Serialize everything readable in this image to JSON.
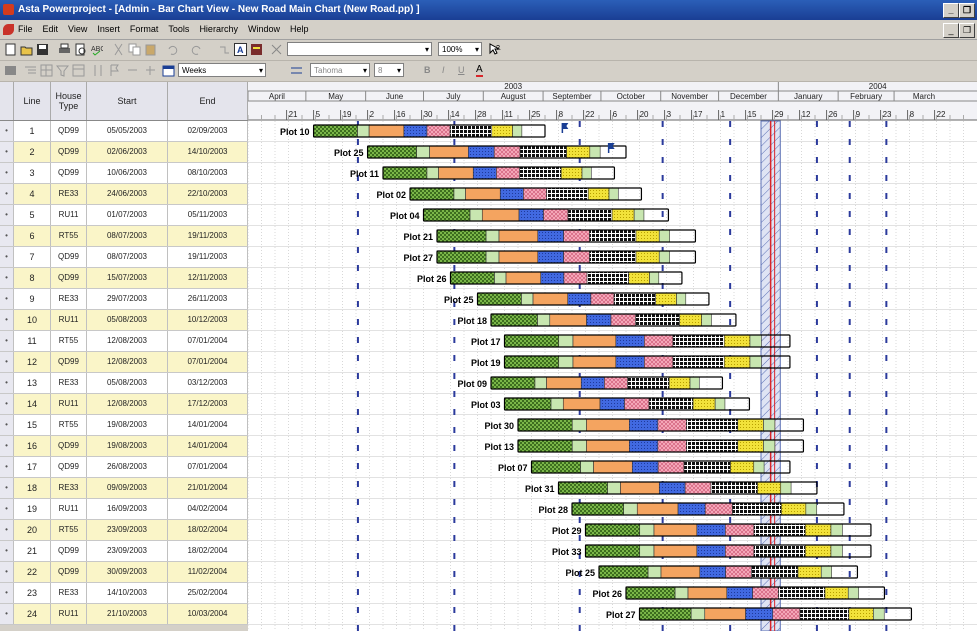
{
  "window": {
    "title": "Asta Powerproject - [Admin - Bar Chart View - New Road Main Chart (New Road.pp) ]",
    "min_label": "_",
    "restore_label": "❐"
  },
  "menu": {
    "items": [
      "File",
      "Edit",
      "View",
      "Insert",
      "Format",
      "Tools",
      "Hierarchy",
      "Window",
      "Help"
    ]
  },
  "toolbar": {
    "zoom": "100%",
    "timescale": "Weeks",
    "font": "Tahoma",
    "font_size": "8",
    "bold": "B",
    "italic": "I",
    "underline": "U",
    "text_color": "A"
  },
  "columns": {
    "line": "Line",
    "house_type": "House Type",
    "start": "Start",
    "end": "End"
  },
  "years": [
    {
      "label": "2003",
      "month_index": 0
    },
    {
      "label": "2004",
      "month_index": 9
    }
  ],
  "months": [
    "April",
    "May",
    "June",
    "July",
    "August",
    "September",
    "October",
    "November",
    "December",
    "January",
    "February",
    "March"
  ],
  "week_ticks": [
    "21",
    "5",
    "19",
    "2",
    "16",
    "30",
    "14",
    "28",
    "11",
    "25",
    "8",
    "22",
    "6",
    "20",
    "3",
    "17",
    "1",
    "15",
    "29",
    "12",
    "26",
    "9",
    "23",
    "8",
    "22"
  ],
  "rows": [
    {
      "line": "1",
      "type": "QD99",
      "start": "05/05/2003",
      "end": "02/09/2003",
      "plot": "Plot 10",
      "highlight": false
    },
    {
      "line": "2",
      "type": "QD99",
      "start": "02/06/2003",
      "end": "14/10/2003",
      "plot": "Plot 25",
      "highlight": true
    },
    {
      "line": "3",
      "type": "QD99",
      "start": "10/06/2003",
      "end": "08/10/2003",
      "plot": "Plot 11",
      "highlight": false
    },
    {
      "line": "4",
      "type": "RE33",
      "start": "24/06/2003",
      "end": "22/10/2003",
      "plot": "Plot 02",
      "highlight": true
    },
    {
      "line": "5",
      "type": "RU11",
      "start": "01/07/2003",
      "end": "05/11/2003",
      "plot": "Plot 04",
      "highlight": false
    },
    {
      "line": "6",
      "type": "RT55",
      "start": "08/07/2003",
      "end": "19/11/2003",
      "plot": "Plot 21",
      "highlight": true
    },
    {
      "line": "7",
      "type": "QD99",
      "start": "08/07/2003",
      "end": "19/11/2003",
      "plot": "Plot 27",
      "highlight": false
    },
    {
      "line": "8",
      "type": "QD99",
      "start": "15/07/2003",
      "end": "12/11/2003",
      "plot": "Plot 26",
      "highlight": true
    },
    {
      "line": "9",
      "type": "RE33",
      "start": "29/07/2003",
      "end": "26/11/2003",
      "plot": "Plot 25",
      "highlight": false
    },
    {
      "line": "10",
      "type": "RU11",
      "start": "05/08/2003",
      "end": "10/12/2003",
      "plot": "Plot 18",
      "highlight": true
    },
    {
      "line": "11",
      "type": "RT55",
      "start": "12/08/2003",
      "end": "07/01/2004",
      "plot": "Plot 17",
      "highlight": false
    },
    {
      "line": "12",
      "type": "QD99",
      "start": "12/08/2003",
      "end": "07/01/2004",
      "plot": "Plot 19",
      "highlight": true
    },
    {
      "line": "13",
      "type": "RE33",
      "start": "05/08/2003",
      "end": "03/12/2003",
      "plot": "Plot 09",
      "highlight": false
    },
    {
      "line": "14",
      "type": "RU11",
      "start": "12/08/2003",
      "end": "17/12/2003",
      "plot": "Plot 03",
      "highlight": true
    },
    {
      "line": "15",
      "type": "RT55",
      "start": "19/08/2003",
      "end": "14/01/2004",
      "plot": "Plot 30",
      "highlight": false
    },
    {
      "line": "16",
      "type": "QD99",
      "start": "19/08/2003",
      "end": "14/01/2004",
      "plot": "Plot 13",
      "highlight": true
    },
    {
      "line": "17",
      "type": "QD99",
      "start": "26/08/2003",
      "end": "07/01/2004",
      "plot": "Plot 07",
      "highlight": false
    },
    {
      "line": "18",
      "type": "RE33",
      "start": "09/09/2003",
      "end": "21/01/2004",
      "plot": "Plot 31",
      "highlight": true
    },
    {
      "line": "19",
      "type": "RU11",
      "start": "16/09/2003",
      "end": "04/02/2004",
      "plot": "Plot 28",
      "highlight": false
    },
    {
      "line": "20",
      "type": "RT55",
      "start": "23/09/2003",
      "end": "18/02/2004",
      "plot": "Plot 29",
      "highlight": true
    },
    {
      "line": "21",
      "type": "QD99",
      "start": "23/09/2003",
      "end": "18/02/2004",
      "plot": "Plot 33",
      "highlight": false
    },
    {
      "line": "22",
      "type": "QD99",
      "start": "30/09/2003",
      "end": "11/02/2004",
      "plot": "Plot 25",
      "highlight": true
    },
    {
      "line": "23",
      "type": "RE33",
      "start": "14/10/2003",
      "end": "25/02/2004",
      "plot": "Plot 26",
      "highlight": false
    },
    {
      "line": "24",
      "type": "RU11",
      "start": "21/10/2003",
      "end": "10/03/2004",
      "plot": "Plot 27",
      "highlight": true
    }
  ],
  "task_colors": [
    "#7ab648",
    "#c8e6b0",
    "#f4a460",
    "#4169e1",
    "#f4a6b8",
    "#202020",
    "#f2e23a",
    "#c8e6b0"
  ],
  "colors": {
    "highlight_row": "#faf5c8",
    "normal_row": "#ffffff",
    "progress_line": "#d9252a",
    "milestone_line": "#2b3a9c"
  }
}
